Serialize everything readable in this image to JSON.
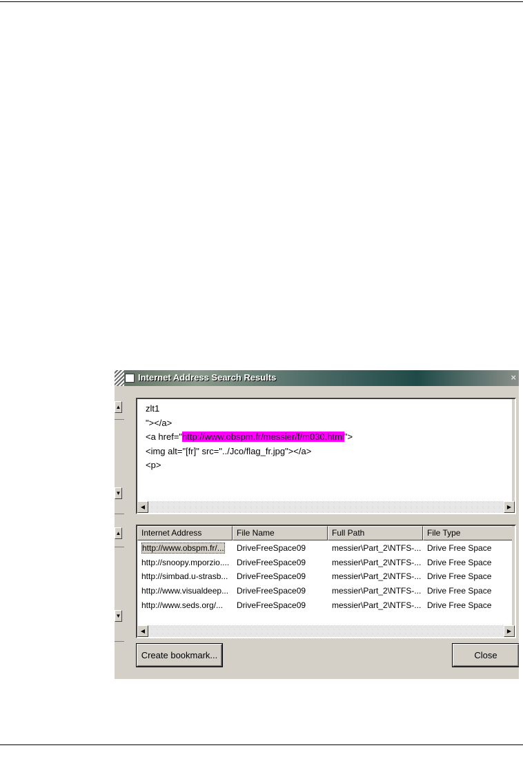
{
  "window": {
    "title": "Internet Address Search Results",
    "close_glyph": "×"
  },
  "source_text": {
    "lines": {
      "l1": "zlt1",
      "l2": "\"></a>",
      "l3_before": "<a href=\"",
      "l3_link": "http://www.obspm.fr/messier/f/m030.html",
      "l3_after": "\">",
      "l4": "<img alt=\"[fr]\" src=\"../Jco/flag_fr.jpg\"></a>",
      "l5": "<p>"
    },
    "highlight_color": "#ff00ff"
  },
  "results": {
    "columns": {
      "c0": "Internet Address",
      "c1": "File Name",
      "c2": "Full Path",
      "c3": "File Type"
    },
    "rows": [
      {
        "address": "http://www.obspm.fr/...",
        "file_name": "DriveFreeSpace09",
        "full_path": "messier\\Part_2\\NTFS-...",
        "file_type": "Drive Free Space",
        "selected": true
      },
      {
        "address": "http://snoopy.mporzio....",
        "file_name": "DriveFreeSpace09",
        "full_path": "messier\\Part_2\\NTFS-...",
        "file_type": "Drive Free Space"
      },
      {
        "address": "http://simbad.u-strasb...",
        "file_name": "DriveFreeSpace09",
        "full_path": "messier\\Part_2\\NTFS-...",
        "file_type": "Drive Free Space"
      },
      {
        "address": "http://www.visualdeep...",
        "file_name": "DriveFreeSpace09",
        "full_path": "messier\\Part_2\\NTFS-...",
        "file_type": "Drive Free Space"
      },
      {
        "address": "http://www.seds.org/...",
        "file_name": "DriveFreeSpace09",
        "full_path": "messier\\Part_2\\NTFS-...",
        "file_type": "Drive Free Space"
      }
    ]
  },
  "buttons": {
    "create_bookmark": "Create bookmark...",
    "close": "Close"
  },
  "icons": {
    "scroll_up": "▲",
    "scroll_down": "▼",
    "scroll_left": "◀",
    "scroll_right": "▶"
  }
}
